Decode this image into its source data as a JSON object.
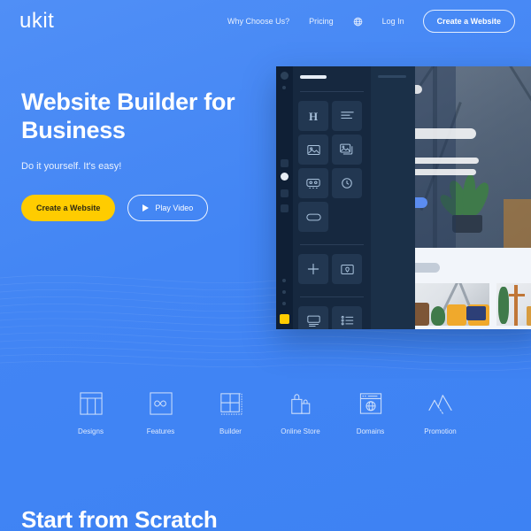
{
  "theme": {
    "bg_blue": "#4285f4",
    "accent_yellow": "#ffcc00",
    "text_white": "#ffffff",
    "panel_dark": "#16283f"
  },
  "header": {
    "logo": "ukit",
    "nav": [
      {
        "label": "Why Choose Us?",
        "name": "nav-why-choose-us"
      },
      {
        "label": "Pricing",
        "name": "nav-pricing"
      }
    ],
    "language_icon": "globe-icon",
    "login_label": "Log In",
    "cta_label": "Create a Website"
  },
  "hero": {
    "title_line1": "Website Builder for",
    "title_line2": "Business",
    "subtitle": "Do it yourself. It's easy!",
    "primary_button": "Create a Website",
    "secondary_button": "Play Video",
    "play_icon": "play-triangle-icon"
  },
  "mockup": {
    "name": "website-builder-preview",
    "rail_icons": [
      "square-icon",
      "circle-active-icon",
      "square-icon",
      "square-icon",
      "dot-icon",
      "dot-icon",
      "dot-icon",
      "yellow-square-icon"
    ],
    "tools": [
      {
        "name": "heading-tool-icon",
        "glyph": "H"
      },
      {
        "name": "text-block-tool-icon",
        "glyph": ""
      },
      {
        "name": "image-tool-icon",
        "glyph": ""
      },
      {
        "name": "gallery-tool-icon",
        "glyph": ""
      },
      {
        "name": "video-tool-icon",
        "glyph": ""
      },
      {
        "name": "clock-tool-icon",
        "glyph": ""
      },
      {
        "name": "button-tool-icon",
        "glyph": ""
      },
      {
        "name": "add-block-tool-icon",
        "glyph": ""
      },
      {
        "name": "map-tool-icon",
        "glyph": ""
      },
      {
        "name": "form-tool-icon",
        "glyph": ""
      },
      {
        "name": "list-tool-icon",
        "glyph": ""
      }
    ]
  },
  "features": [
    {
      "label": "Designs",
      "icon": "layout-columns-icon"
    },
    {
      "label": "Features",
      "icon": "infinity-box-icon"
    },
    {
      "label": "Builder",
      "icon": "grid-four-icon"
    },
    {
      "label": "Online Store",
      "icon": "shopping-bags-icon"
    },
    {
      "label": "Domains",
      "icon": "browser-globe-icon"
    },
    {
      "label": "Promotion",
      "icon": "chart-peaks-icon"
    }
  ],
  "section": {
    "scratch_title": "Start from Scratch"
  }
}
